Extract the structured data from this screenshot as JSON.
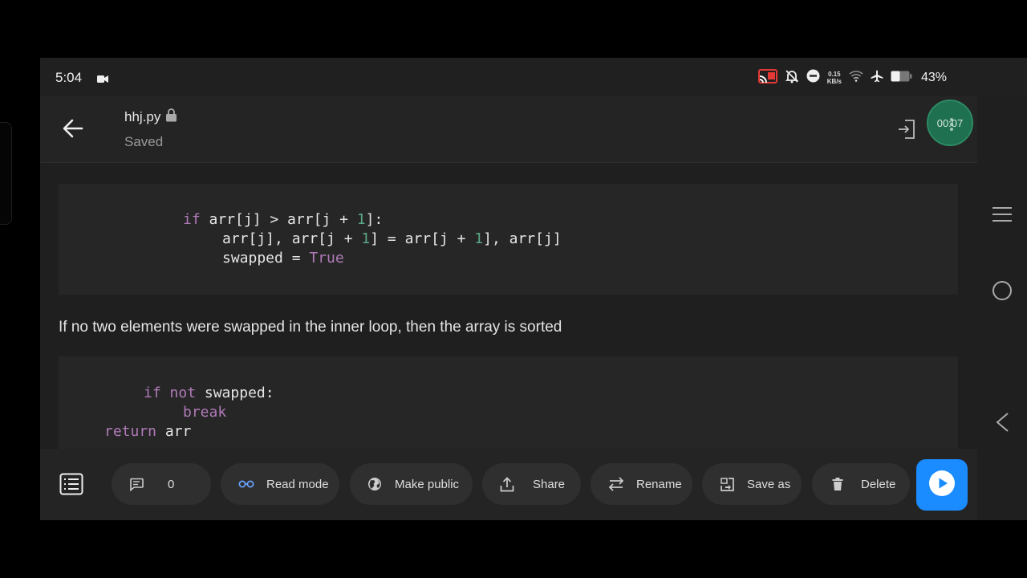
{
  "status_bar": {
    "time": "5:04",
    "net_speed_value": "0.15",
    "net_speed_unit": "KB/s",
    "battery": "43%"
  },
  "app_bar": {
    "file_name": "hhj.py",
    "save_state": "Saved",
    "recording_timer": "00:07"
  },
  "content": {
    "paragraph": "If no two elements were swapped in the inner loop, then the array is sorted",
    "code_block_1": {
      "line_1": {
        "kw": "if",
        "a": " arr[j] > arr[j + ",
        "num": "1",
        "b": "]:"
      },
      "line_2": {
        "a": "arr[j], arr[j + ",
        "num1": "1",
        "b": "] = arr[j + ",
        "num2": "1",
        "c": "], arr[j]"
      },
      "line_3": {
        "a": "swapped = ",
        "bool": "True"
      }
    },
    "code_block_2": {
      "line_1": {
        "kw1": "if",
        "kw2": " not",
        "a": " swapped:"
      },
      "line_2": {
        "kw": "break"
      },
      "line_3": {
        "kw": "return",
        "a": " arr"
      }
    }
  },
  "bottom_bar": {
    "comments_count": "0",
    "read_mode": "Read mode",
    "make_public": "Make public",
    "share": "Share",
    "rename": "Rename",
    "save_as": "Save as",
    "delete": "Delete"
  },
  "icons": {
    "back": "arrow-left-icon",
    "lock": "lock-icon",
    "exit": "exit-icon",
    "more": "more-vert-icon",
    "list": "list-icon",
    "comment": "comment-icon",
    "read_mode": "glasses-icon",
    "globe": "globe-icon",
    "share": "upload-icon",
    "rename": "swap-icon",
    "save_as": "save-as-icon",
    "delete": "trash-icon",
    "run": "play-icon",
    "menu": "menu-icon",
    "home": "circle-icon",
    "nav_back": "triangle-back-icon"
  },
  "colors": {
    "accent_blue": "#1a8cff",
    "recording_green": "#1f7050",
    "keyword_purple": "#b07ab8",
    "number_green": "#5aa787"
  }
}
